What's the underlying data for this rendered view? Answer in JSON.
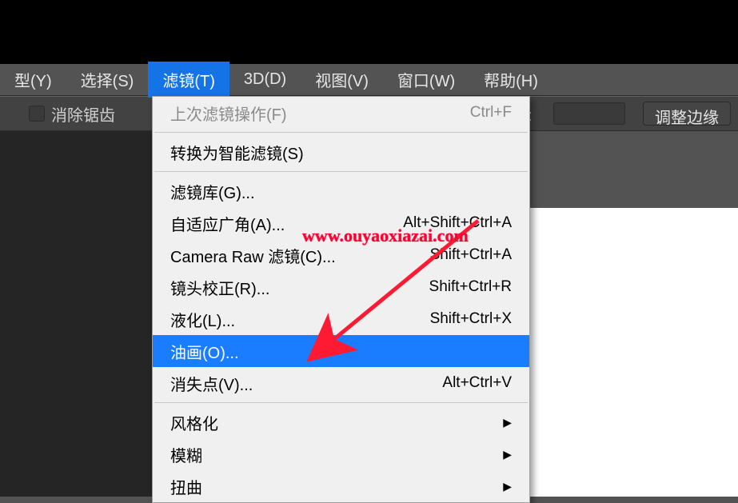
{
  "menubar": {
    "items": [
      {
        "label": "型(Y)"
      },
      {
        "label": "选择(S)"
      },
      {
        "label": "滤镜(T)"
      },
      {
        "label": "3D(D)"
      },
      {
        "label": "视图(V)"
      },
      {
        "label": "窗口(W)"
      },
      {
        "label": "帮助(H)"
      }
    ],
    "active_index": 2
  },
  "option_bar": {
    "antialias_label": "消除锯齿",
    "du_label": "度:",
    "adjust_edge_label": "调整边缘"
  },
  "dropdown": {
    "groups": [
      [
        {
          "label": "上次滤镜操作(F)",
          "shortcut": "Ctrl+F",
          "disabled": true,
          "submenu": false
        }
      ],
      [
        {
          "label": "转换为智能滤镜(S)",
          "shortcut": "",
          "disabled": false,
          "submenu": false
        }
      ],
      [
        {
          "label": "滤镜库(G)...",
          "shortcut": "",
          "disabled": false,
          "submenu": false
        },
        {
          "label": "自适应广角(A)...",
          "shortcut": "Alt+Shift+Ctrl+A",
          "disabled": false,
          "submenu": false
        },
        {
          "label": "Camera Raw 滤镜(C)...",
          "shortcut": "Shift+Ctrl+A",
          "disabled": false,
          "submenu": false
        },
        {
          "label": "镜头校正(R)...",
          "shortcut": "Shift+Ctrl+R",
          "disabled": false,
          "submenu": false
        },
        {
          "label": "液化(L)...",
          "shortcut": "Shift+Ctrl+X",
          "disabled": false,
          "submenu": false
        },
        {
          "label": "油画(O)...",
          "shortcut": "",
          "disabled": false,
          "submenu": false,
          "highlight": true
        },
        {
          "label": "消失点(V)...",
          "shortcut": "Alt+Ctrl+V",
          "disabled": false,
          "submenu": false
        }
      ],
      [
        {
          "label": "风格化",
          "shortcut": "",
          "disabled": false,
          "submenu": true
        },
        {
          "label": "模糊",
          "shortcut": "",
          "disabled": false,
          "submenu": true
        },
        {
          "label": "扭曲",
          "shortcut": "",
          "disabled": false,
          "submenu": true
        }
      ]
    ]
  },
  "watermark": {
    "text": "www.ouyaoxiazai.com"
  },
  "colors": {
    "highlight": "#1a7cff",
    "accent_red": "#ff1a33"
  }
}
